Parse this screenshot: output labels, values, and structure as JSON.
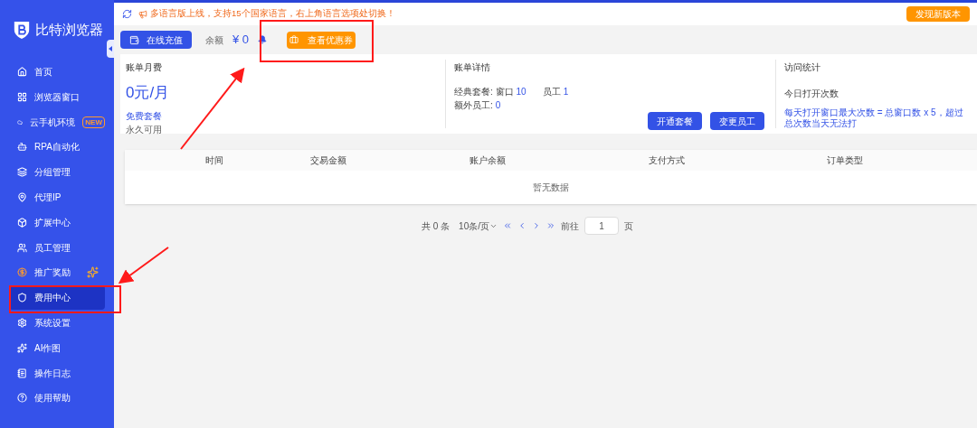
{
  "sidebar": {
    "logo": "比特浏览器",
    "items": [
      {
        "label": "首页",
        "selected": false
      },
      {
        "label": "浏览器窗口",
        "selected": false
      },
      {
        "label": "云手机环境",
        "selected": false,
        "badge": "NEW"
      },
      {
        "label": "RPA自动化",
        "selected": false
      },
      {
        "label": "分组管理",
        "selected": false
      },
      {
        "label": "代理IP",
        "selected": false
      },
      {
        "label": "扩展中心",
        "selected": false
      },
      {
        "label": "员工管理",
        "selected": false
      },
      {
        "label": "推广奖励",
        "selected": false,
        "sparkle": true
      },
      {
        "label": "费用中心",
        "selected": true
      },
      {
        "label": "系统设置",
        "selected": false
      },
      {
        "label": "AI作图",
        "selected": false
      },
      {
        "label": "操作日志",
        "selected": false
      },
      {
        "label": "使用帮助",
        "selected": false
      }
    ]
  },
  "notice": {
    "text": "多语言版上线，支持15个国家语言，右上角语言选项处切换！",
    "update_button": "发现新版本"
  },
  "toolbar": {
    "recharge_button": "在线充值",
    "balance_label": "余额",
    "balance_value": "¥ 0",
    "coupon_button": "查看优惠券"
  },
  "bill_month": {
    "title": "账单月费",
    "amount": "0元/月",
    "plan": "免费套餐",
    "validity": "永久可用"
  },
  "bill_detail": {
    "title": "账单详情",
    "classic_label": "经典套餐: 窗口",
    "classic_value": "10",
    "staff_label": "员工",
    "staff_value": "1",
    "extra_label": "额外员工:",
    "extra_value": "0",
    "buttons": [
      "开通套餐",
      "变更员工"
    ]
  },
  "visits": {
    "title": "访问统计",
    "today_label": "今日打开次数",
    "rule": "每天打开窗口最大次数 = 总窗口数 x 5，超过总次数当天无法打"
  },
  "table": {
    "columns": [
      "时间",
      "交易金额",
      "账户余额",
      "支付方式",
      "订单类型"
    ],
    "empty": "暂无数据"
  },
  "pagination": {
    "total": "共 0 条",
    "page_size": "10条/页",
    "goto_label": "前往",
    "page": "1",
    "page_suffix": "页"
  }
}
